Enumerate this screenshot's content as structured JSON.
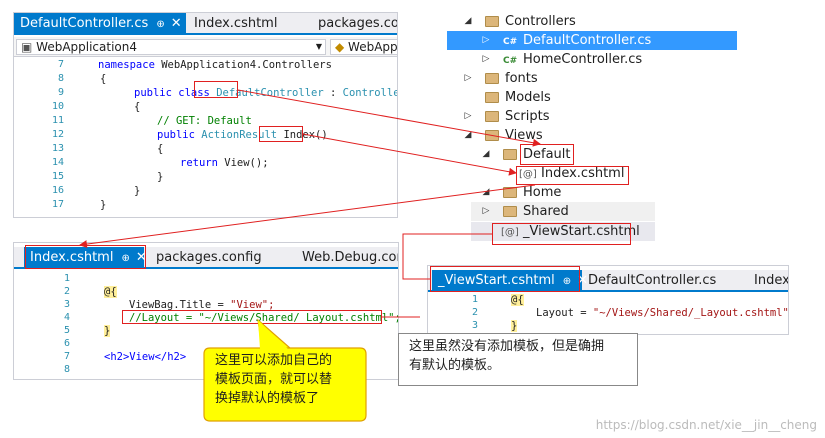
{
  "editor1": {
    "tabs": [
      {
        "label": "DefaultController.cs",
        "pin": "⊕",
        "close": "✕",
        "active": true
      },
      {
        "label": "Index.cshtml",
        "active": false
      },
      {
        "label": "packages.confi",
        "active": false
      }
    ],
    "project": "WebApplication4",
    "class_nav": "WebApplic",
    "lines": [
      {
        "n": "7"
      },
      {
        "n": "8"
      },
      {
        "n": "9"
      },
      {
        "n": "10"
      },
      {
        "n": "11"
      },
      {
        "n": "12"
      },
      {
        "n": "13"
      },
      {
        "n": "14"
      },
      {
        "n": "15"
      },
      {
        "n": "16"
      },
      {
        "n": "17"
      }
    ],
    "code": {
      "namespace_kw": "namespace",
      "namespace_name": " WebApplication4.Controllers",
      "brace_open": "{",
      "public_class": "public class ",
      "class_name": "DefaultController",
      "base": " : ",
      "base_name": "Controller",
      "comment": "// GET: Default",
      "public_kw": "public ",
      "return_type": "ActionResult",
      "method": "Index()",
      "return_kw": "return ",
      "view_call": "View();",
      "brace_close": "}"
    }
  },
  "solution": {
    "items": [
      {
        "label": "Controllers",
        "arrow": "◢",
        "icon": "folder"
      },
      {
        "label": "DefaultController.cs",
        "arrow": "▷",
        "icon": "C#",
        "selected": true
      },
      {
        "label": "HomeController.cs",
        "arrow": "▷",
        "icon": "C#"
      },
      {
        "label": "fonts",
        "arrow": "▷",
        "icon": "folder"
      },
      {
        "label": "Models",
        "arrow": "",
        "icon": "folder"
      },
      {
        "label": "Scripts",
        "arrow": "▷",
        "icon": "folder"
      },
      {
        "label": "Views",
        "arrow": "◢",
        "icon": "folder"
      },
      {
        "label": "Default",
        "arrow": "◢",
        "icon": "folder"
      },
      {
        "label": "Index.cshtml",
        "arrow": "",
        "icon": "[@]"
      },
      {
        "label": "Home",
        "arrow": "◢",
        "icon": "folder"
      },
      {
        "label": "Shared",
        "arrow": "▷",
        "icon": "folder"
      },
      {
        "label": "_ViewStart.cshtml",
        "arrow": "",
        "icon": "[@]"
      }
    ]
  },
  "editor2": {
    "tabs": [
      {
        "label": "Index.cshtml",
        "pin": "⊕",
        "close": "✕",
        "active": true
      },
      {
        "label": "packages.config",
        "active": false
      },
      {
        "label": "Web.Debug.confi",
        "active": false
      }
    ],
    "lines": [
      "1",
      "2",
      "3",
      "4",
      "5",
      "6",
      "7",
      "8"
    ],
    "code": {
      "razor_open": "@{",
      "viewbag": "ViewBag.Title = ",
      "viewbag_val": "\"View\";",
      "layout_comment": "//Layout = \"~/Views/Shared/_Layout.cshtml\";",
      "razor_close": "}",
      "h2": "<h2>View</h2>"
    }
  },
  "editor3": {
    "tabs": [
      {
        "label": "_ViewStart.cshtml",
        "pin": "⊕",
        "close": "✕",
        "active": true
      },
      {
        "label": "DefaultController.cs",
        "active": false
      },
      {
        "label": "Index.",
        "active": false
      }
    ],
    "lines": [
      "1",
      "2",
      "3"
    ],
    "code": {
      "razor_open": "@{",
      "layout": "Layout = ",
      "layout_val": "\"~/Views/Shared/_Layout.cshtml\";",
      "razor_close": "}"
    }
  },
  "callouts": {
    "yellow": "这里可以添加自己的\n模板页面，就可以替\n换掉默认的模板了",
    "white": "这里虽然没有添加模板，但是确拥\n有默认的模板。"
  },
  "watermark": "https://blog.csdn.net/xie__jin__cheng",
  "colors": {
    "accent": "#007acc",
    "selection": "#3399ff",
    "highlight": "#e02020",
    "callout": "#ffff00"
  }
}
